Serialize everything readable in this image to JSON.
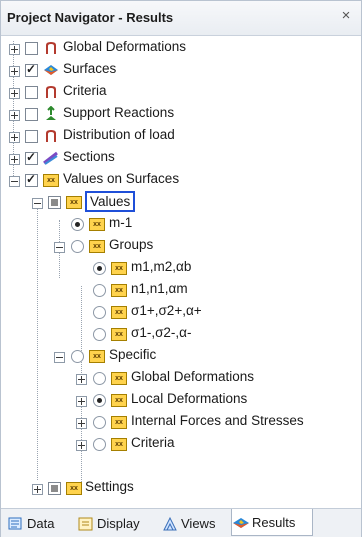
{
  "window": {
    "title": "Project Navigator - Results",
    "close_glyph": "×"
  },
  "tree": {
    "global_deformations": "Global Deformations",
    "surfaces": "Surfaces",
    "criteria": "Criteria",
    "support_reactions": "Support Reactions",
    "distribution_of_load": "Distribution of load",
    "sections": "Sections",
    "values_on_surfaces": "Values on Surfaces",
    "values": "Values",
    "m1": "m-1",
    "groups": "Groups",
    "g1": "m1,m2,αb",
    "g2": "n1,n1,αm",
    "g3": "σ1+,σ2+,α+",
    "g4": "σ1-,σ2-,α-",
    "specific": "Specific",
    "s_global": "Global Deformations",
    "s_local": "Local Deformations",
    "s_internal": "Internal Forces and Stresses",
    "s_criteria": "Criteria",
    "settings": "Settings",
    "xx_badge": "xx"
  },
  "tabs": [
    "Data",
    "Display",
    "Views",
    "Results"
  ],
  "colors": {
    "selection_border": "#1f4fd8",
    "xx_icon": "#ffd34d"
  }
}
